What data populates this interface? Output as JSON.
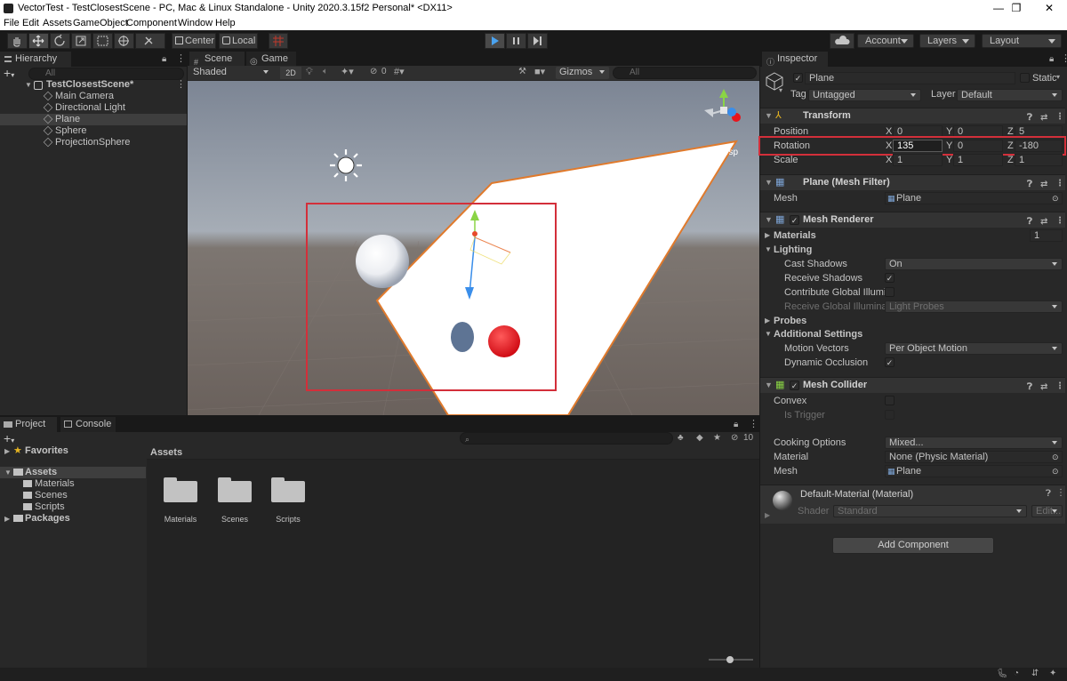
{
  "window": {
    "title": "VectorTest - TestClosestScene - PC, Mac & Linux Standalone - Unity 2020.3.15f2 Personal* <DX11>",
    "minimize": "—",
    "restore": "❐",
    "close": "✕"
  },
  "menu": [
    "File",
    "Edit",
    "Assets",
    "GameObject",
    "Component",
    "Window",
    "Help"
  ],
  "toolbar": {
    "pivot_label": "Center",
    "space_label": "Local",
    "account_label": "Account",
    "layers_label": "Layers",
    "layout_label": "Layout"
  },
  "hierarchy": {
    "tab_label": "Hierarchy",
    "search_placeholder": "All",
    "scene_name": "TestClosestScene*",
    "items": [
      "Main Camera",
      "Directional Light",
      "Plane",
      "Sphere",
      "ProjectionSphere"
    ],
    "selected_index": 2
  },
  "scene_view": {
    "tabs": [
      "Scene",
      "Game"
    ],
    "shading_mode": "Shaded",
    "mode_2d": "2D",
    "hidden_count": "0",
    "gizmos_label": "Gizmos",
    "search_placeholder": "All",
    "persp_label": "Persp"
  },
  "project": {
    "tabs": [
      "Project",
      "Console"
    ],
    "favorites_label": "Favorites",
    "assets_label": "Assets",
    "asset_folders": [
      "Materials",
      "Scenes",
      "Scripts"
    ],
    "packages_label": "Packages",
    "breadcrumb": "Assets",
    "hidden_count": "10",
    "grid_items": [
      "Materials",
      "Scenes",
      "Scripts"
    ]
  },
  "inspector": {
    "tab_label": "Inspector",
    "object_name": "Plane",
    "static_label": "Static",
    "tag_label": "Tag",
    "tag_value": "Untagged",
    "layer_label": "Layer",
    "layer_value": "Default",
    "transform": {
      "header": "Transform",
      "position_label": "Position",
      "position": {
        "x": "0",
        "y": "0",
        "z": "5"
      },
      "rotation_label": "Rotation",
      "rotation": {
        "x": "135",
        "y": "0",
        "z": "-180"
      },
      "scale_label": "Scale",
      "scale": {
        "x": "1",
        "y": "1",
        "z": "1"
      }
    },
    "mesh_filter": {
      "header": "Plane (Mesh Filter)",
      "mesh_label": "Mesh",
      "mesh_value": "Plane"
    },
    "mesh_renderer": {
      "header": "Mesh Renderer",
      "materials_label": "Materials",
      "materials_count": "1",
      "lighting_label": "Lighting",
      "cast_shadows_label": "Cast Shadows",
      "cast_shadows_value": "On",
      "receive_shadows_label": "Receive Shadows",
      "contribute_gi_label": "Contribute Global Illumi",
      "receive_gi_label": "Receive Global Illumina",
      "receive_gi_value": "Light Probes",
      "probes_label": "Probes",
      "additional_label": "Additional Settings",
      "motion_vectors_label": "Motion Vectors",
      "motion_vectors_value": "Per Object Motion",
      "dynamic_occlusion_label": "Dynamic Occlusion"
    },
    "mesh_collider": {
      "header": "Mesh Collider",
      "convex_label": "Convex",
      "is_trigger_label": "Is Trigger",
      "cooking_label": "Cooking Options",
      "cooking_value": "Mixed...",
      "material_label": "Material",
      "material_value": "None (Physic Material)",
      "mesh_label": "Mesh",
      "mesh_value": "Plane"
    },
    "material": {
      "header": "Default-Material (Material)",
      "shader_label": "Shader",
      "shader_value": "Standard",
      "edit_label": "Edit..."
    },
    "add_component_label": "Add Component",
    "axis_labels": [
      "X",
      "Y",
      "Z"
    ]
  },
  "colors": {
    "highlight_red": "#d32f3a",
    "plane_outline": "#e07a2c",
    "sphere_red": "#e8141c",
    "sky_top": "#9fa8b4",
    "ground": "#6e6560"
  }
}
